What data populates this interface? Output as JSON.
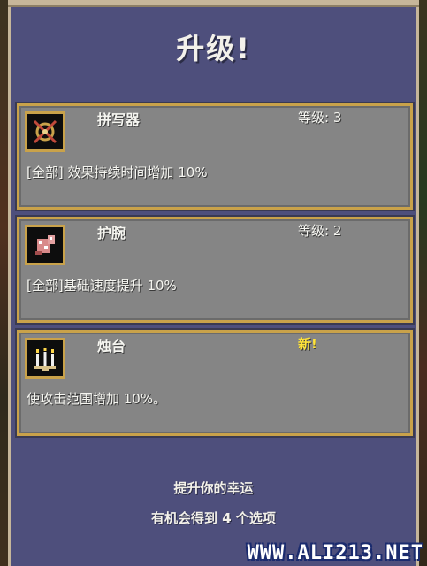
{
  "title": "升级!",
  "cards": [
    {
      "name": "拼写器",
      "level_text": "等级: 3",
      "description": "[全部] 效果持续时间增加 10%",
      "icon": "spellbinder-icon",
      "is_new": false
    },
    {
      "name": "护腕",
      "level_text": "等级: 2",
      "description": "[全部]基础速度提升 10%",
      "icon": "bracer-icon",
      "is_new": false
    },
    {
      "name": "烛台",
      "level_text": "新!",
      "description": "使攻击范围增加 10%。",
      "icon": "candelabrador-icon",
      "is_new": true
    }
  ],
  "footer": {
    "line1": "提升你的幸运",
    "line2": "有机会得到 4 个选项"
  },
  "watermark": "WWW.ALI213.NET",
  "colors": {
    "panel": "#4e4f7c",
    "card": "#858585",
    "card_border": "#c9a24a",
    "new_label": "#ffe33a"
  }
}
